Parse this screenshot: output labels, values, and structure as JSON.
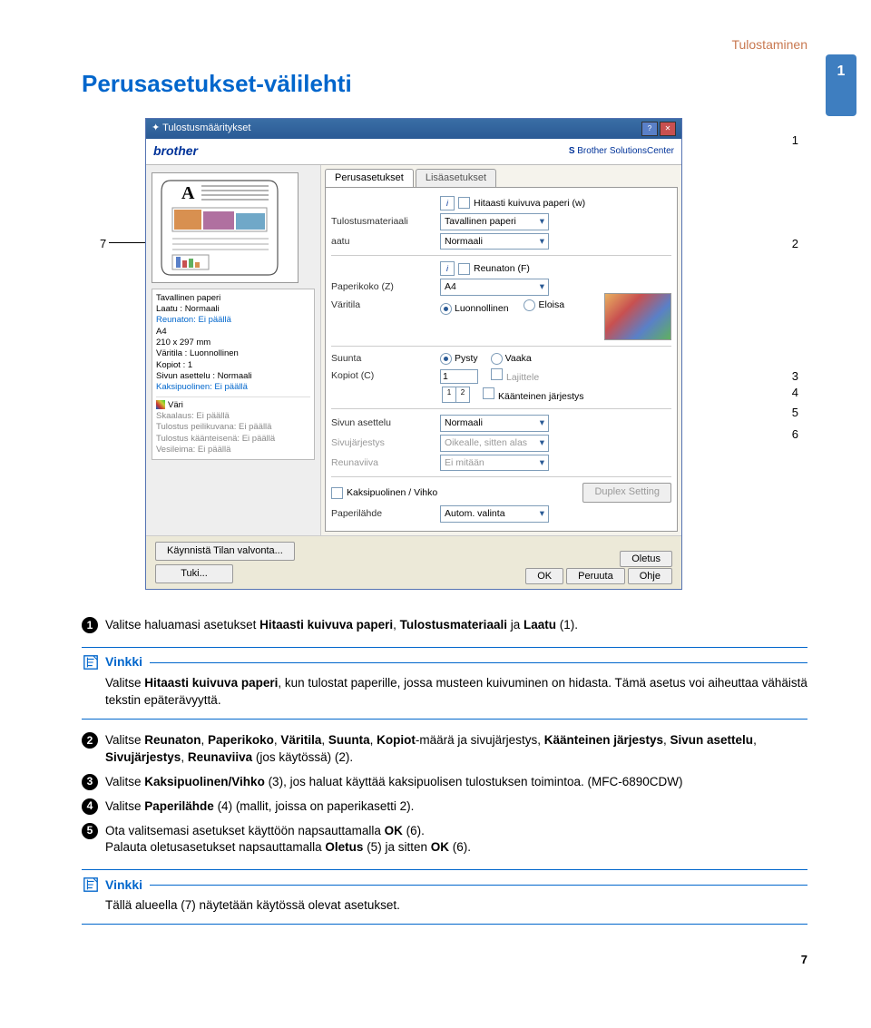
{
  "header_section": "Tulostaminen",
  "chapter_number": "1",
  "page_title": "Perusasetukset-välilehti",
  "callouts": {
    "c1": "1",
    "c2": "2",
    "c3": "3",
    "c4": "4",
    "c5": "5",
    "c6": "6",
    "c7": "7"
  },
  "dialog": {
    "title": "Tulostusmääritykset",
    "brand": "brother",
    "solutions": "Brother SolutionsCenter",
    "tab_basic": "Perusasetukset",
    "tab_adv": "Lisäasetukset",
    "info": {
      "l1": "Tavallinen paperi",
      "l2": "Laatu : Normaali",
      "l3": "Reunaton: Ei päällä",
      "l4": "A4",
      "l5": "210 x 297 mm",
      "l6": "Väritila : Luonnollinen",
      "l7": "Kopiot : 1",
      "l8": "Sivun asettelu : Normaali",
      "l9": "Kaksipuolinen: Ei päällä",
      "l10": "Väri",
      "l11": "Skaalaus: Ei päällä",
      "l12": "Tulostus peilikuvana: Ei päällä",
      "l13": "Tulostus käänteisenä: Ei päällä",
      "l14": "Vesileima: Ei päällä"
    },
    "rows": {
      "slow_chk": "Hitaasti kuivuva paperi (w)",
      "media_lbl": "Tulostusmateriaali",
      "media_val": "Tavallinen paperi",
      "quality_lbl": "aatu",
      "quality_val": "Normaali",
      "borderless": "Reunaton (F)",
      "size_lbl": "Paperikoko (Z)",
      "size_val": "A4",
      "mode_lbl": "Väritila",
      "mode1": "Luonnollinen",
      "mode2": "Eloisa",
      "orient_lbl": "Suunta",
      "orient1": "Pysty",
      "orient2": "Vaaka",
      "copies_lbl": "Kopiot (C)",
      "copies_val": "1",
      "collate": "Lajittele",
      "reverse": "Käänteinen järjestys",
      "layout_lbl": "Sivun asettelu",
      "layout_val": "Normaali",
      "pageorder_lbl": "Sivujärjestys",
      "pageorder_val": "Oikealle, sitten alas",
      "borderline_lbl": "Reunaviiva",
      "borderline_val": "Ei mitään",
      "duplex_chk": "Kaksipuolinen / Vihko",
      "duplex_btn": "Duplex Setting",
      "source_lbl": "Paperilähde",
      "source_val": "Autom. valinta"
    },
    "buttons": {
      "status": "Käynnistä Tilan valvonta...",
      "support": "Tuki...",
      "default": "Oletus",
      "ok": "OK",
      "cancel": "Peruuta",
      "help": "Ohje"
    }
  },
  "steps": {
    "s1_pre": "Valitse haluamasi asetukset ",
    "s1_b1": "Hitaasti kuivuva paperi",
    "s1_mid": ", ",
    "s1_b2": "Tulostusmateriaali",
    "s1_mid2": " ja ",
    "s1_b3": "Laatu",
    "s1_tail": " (1).",
    "s2_pre": "Valitse ",
    "s2_b1": "Reunaton",
    "s2_c": ", ",
    "s2_b2": "Paperikoko",
    "s2_b3": "Väritila",
    "s2_b4": "Suunta",
    "s2_b5": "Kopiot",
    "s2_mid1": "-määrä ja sivujärjestys, ",
    "s2_b6": "Käänteinen järjestys",
    "s2_b7": "Sivun asettelu",
    "s2_b8": "Sivujärjestys",
    "s2_b9": "Reunaviiva",
    "s2_tail": " (jos käytössä) (2).",
    "s3_pre": "Valitse ",
    "s3_b1": "Kaksipuolinen/Vihko",
    "s3_mid": " (3), jos haluat käyttää kaksipuolisen tulostuksen toimintoa. (MFC-6890CDW)",
    "s4_pre": "Valitse ",
    "s4_b1": "Paperilähde",
    "s4_tail": " (4) (mallit, joissa on paperikasetti 2).",
    "s5_pre": "Ota valitsemasi asetukset käyttöön napsauttamalla ",
    "s5_b1": "OK",
    "s5_mid": " (6).",
    "s5_line2_pre": "Palauta oletusasetukset napsauttamalla ",
    "s5_b2": "Oletus",
    "s5_mid2": " (5) ja sitten ",
    "s5_b3": "OK",
    "s5_tail2": " (6)."
  },
  "note": {
    "title": "Vinkki",
    "body1_pre": "Valitse ",
    "body1_b1": "Hitaasti kuivuva paperi",
    "body1_mid": ", kun tulostat paperille, jossa musteen kuivuminen on hidasta. Tämä asetus voi aiheuttaa vähäistä tekstin epäterävyyttä.",
    "body2": "Tällä alueella (7) näytetään käytössä olevat asetukset."
  },
  "page_number": "7"
}
